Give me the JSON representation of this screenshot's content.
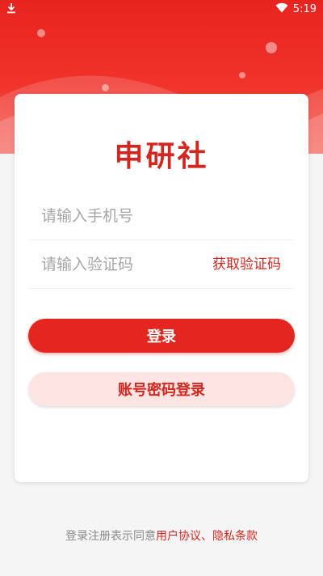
{
  "status_bar": {
    "time": "5:19",
    "left_icon": "download-icon",
    "right_icon": "wifi-icon"
  },
  "app": {
    "logo_text": "申研社"
  },
  "form": {
    "phone_placeholder": "请输入手机号",
    "code_placeholder": "请输入验证码",
    "get_code_label": "获取验证码",
    "login_label": "登录",
    "password_login_label": "账号密码登录"
  },
  "agreement": {
    "prefix": "登录注册表示同意",
    "user_agreement": "用户协议",
    "separator": "、",
    "privacy_policy": "隐私条款"
  },
  "colors": {
    "primary": "#e52620",
    "accent_text": "#d4261e",
    "secondary_button_bg": "#fde5e3"
  }
}
